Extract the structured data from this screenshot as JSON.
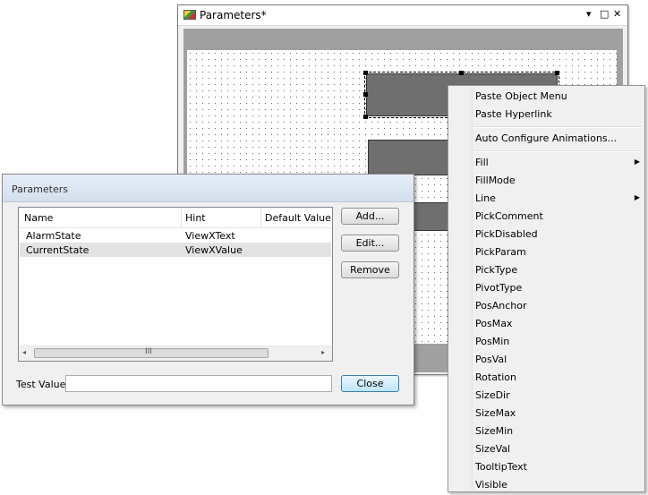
{
  "editor": {
    "title": "Parameters*",
    "controls": {
      "pin": "▾",
      "maximize": "□",
      "close": "✕"
    }
  },
  "dialog": {
    "title": "Parameters",
    "columns": [
      "Name",
      "Hint",
      "Default Value"
    ],
    "rows": [
      {
        "name": "AlarmState",
        "hint": "ViewXText",
        "default": ""
      },
      {
        "name": "CurrentState",
        "hint": "ViewXValue",
        "default": ""
      }
    ],
    "scroll_left": "◂",
    "scroll_right": "▸",
    "scroll_grip": "III",
    "buttons": {
      "add": "Add...",
      "edit": "Edit...",
      "remove": "Remove",
      "close": "Close"
    },
    "test_value_label": "Test Value",
    "test_value": ""
  },
  "menu": {
    "group1": [
      "Paste Object Menu",
      "Paste Hyperlink"
    ],
    "group2": [
      "Auto Configure Animations..."
    ],
    "group3": [
      {
        "label": "Fill",
        "submenu": true
      },
      {
        "label": "FillMode",
        "submenu": false
      },
      {
        "label": "Line",
        "submenu": true
      },
      {
        "label": "PickComment",
        "submenu": false
      },
      {
        "label": "PickDisabled",
        "submenu": false
      },
      {
        "label": "PickParam",
        "submenu": false
      },
      {
        "label": "PickType",
        "submenu": false
      },
      {
        "label": "PivotType",
        "submenu": false
      },
      {
        "label": "PosAnchor",
        "submenu": false
      },
      {
        "label": "PosMax",
        "submenu": false
      },
      {
        "label": "PosMin",
        "submenu": false
      },
      {
        "label": "PosVal",
        "submenu": false
      },
      {
        "label": "Rotation",
        "submenu": false
      },
      {
        "label": "SizeDir",
        "submenu": false
      },
      {
        "label": "SizeMax",
        "submenu": false
      },
      {
        "label": "SizeMin",
        "submenu": false
      },
      {
        "label": "SizeVal",
        "submenu": false
      },
      {
        "label": "TooltipText",
        "submenu": false
      },
      {
        "label": "Visible",
        "submenu": false
      }
    ],
    "submenu_arrow": "▶"
  }
}
